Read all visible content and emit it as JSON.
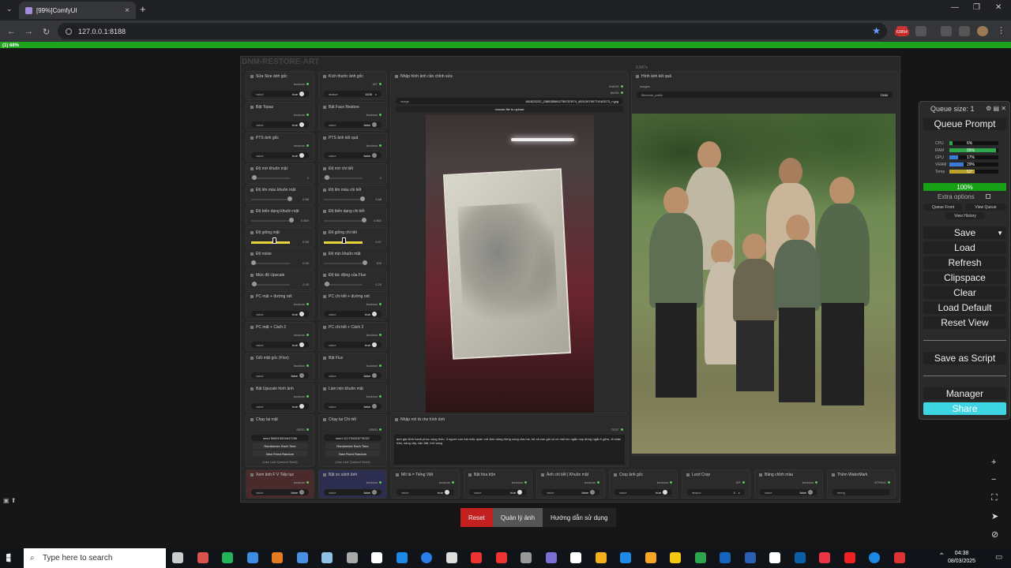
{
  "browser": {
    "tab_title": "[99%]ComfyUI",
    "url": "127.0.0.1:8188",
    "ext_badge": "63854"
  },
  "progress_text": "(1) 68%",
  "group_title": "DNM-RESTORE-ART",
  "nodes": {
    "n1": {
      "title": "Sửa Size ảnh gốc",
      "type": "boolean",
      "val": "true",
      "w": "value"
    },
    "n2": {
      "title": "Kích thước ảnh gốc",
      "type": "INT",
      "val": "1536",
      "w": "value"
    },
    "n3": {
      "title": "Bật Topaz",
      "type": "boolean",
      "val": "true",
      "w": "value"
    },
    "n4": {
      "title": "Bật Face Restore",
      "type": "boolean",
      "val": "false",
      "w": "value"
    },
    "n5": {
      "title": "PTS ảnh gốc",
      "type": "boolean",
      "val": "true",
      "w": "value"
    },
    "n6": {
      "title": "PTS ảnh kết quả",
      "type": "boolean",
      "val": "false",
      "w": "value"
    },
    "n7": {
      "title": "Độ mờ khuôn mặt",
      "val": "2"
    },
    "n8": {
      "title": "Độ mờ chi tiết",
      "val": "2"
    },
    "n9": {
      "title": "Độ lên màu khuôn mặt",
      "val": "0.88"
    },
    "n10": {
      "title": "Độ lên màu chi tiết",
      "val": "0.88"
    },
    "n11": {
      "title": "Độ biến dạng khuôn mặt",
      "val": "0.850"
    },
    "n12": {
      "title": "Độ biến dạng chi tiết",
      "val": "0.850"
    },
    "n13": {
      "title": "Độ giống mặt",
      "val": "0.55"
    },
    "n14": {
      "title": "Độ giống chi tiết",
      "val": "0.57"
    },
    "n15": {
      "title": "Độ noise",
      "val": "0.00"
    },
    "n16": {
      "title": "Độ mịn khuôn mặt",
      "val": "100"
    },
    "n17": {
      "title": "Mức độ Upscale",
      "val": "2.00"
    },
    "n18": {
      "title": "Độ tác động của Flux",
      "val": "0.20"
    },
    "n19": {
      "title": "PC mặt + đường nét",
      "type": "boolean",
      "val": "true",
      "w": "value"
    },
    "n20": {
      "title": "PC chi tiết + đường nét",
      "type": "boolean",
      "val": "true",
      "w": "value"
    },
    "n21": {
      "title": "PC mặt + Cách 2",
      "type": "boolean",
      "val": "true",
      "w": "value"
    },
    "n22": {
      "title": "PC chi tiết + Cách 2",
      "type": "boolean",
      "val": "true",
      "w": "value"
    },
    "n23": {
      "title": "Giữ mặt gốc (Flux)",
      "type": "boolean",
      "val": "false",
      "w": "value"
    },
    "n24": {
      "title": "Bật Flux",
      "type": "boolean",
      "val": "false",
      "w": "value"
    },
    "n25": {
      "title": "Bật Upscale hình ảnh",
      "type": "boolean",
      "val": "true",
      "w": "value"
    },
    "n26": {
      "title": "Làm mịn khuôn mặt",
      "type": "boolean",
      "val": "false",
      "w": "value"
    }
  },
  "seed_a": {
    "title": "Chạy lại mặt",
    "type": "SEED",
    "seed": "seed 568515926647286",
    "rand": "Randomize Each Time",
    "fixed": "New Fixed Random",
    "last": "(Use Last Queued Seed)"
  },
  "seed_b": {
    "title": "Chạy lại Chi tiết",
    "type": "SEED",
    "seed": "seed 121750328778337",
    "rand": "Randomize Each Time",
    "fixed": "New Fixed Random",
    "last": "(Use Last Queued Seed)"
  },
  "input_node": {
    "title": "Nhập hình ảnh cần chỉnh sửa",
    "out1": "IMAGE",
    "out2": "MASK",
    "label": "image",
    "file": "481823222_2368355842758757874_463130790774183273_n.jpg",
    "upload": "choose file to upload"
  },
  "result_node": {
    "title": "Hình ảnh kết quả",
    "label_in": "images",
    "prefix_label": "filename_prefix",
    "prefix_val": "DNM",
    "size": "0.847s"
  },
  "text_node": {
    "title": "Nhập mô tả cho hình ảnh",
    "type": "TEXT",
    "text": "ảnh gia đình hạnh phúc vùng thôn, 3 người con trai mặc quần với đơn dòng đứng cùng cha mẹ, kệ cả con gái có cô mái tóc ngắn cạp đứng ngắt ở giữa, đi chân trần, sáng cây, sân đất, trời sáng"
  },
  "bottom_nodes": [
    {
      "title": "Xem ảnh F V Tiếp tục",
      "type": "boolean",
      "w": "value",
      "val": "false"
    },
    {
      "title": "Bật so sánh ảnh",
      "type": "boolean",
      "w": "value",
      "val": "false"
    },
    {
      "title": "Mô tả = Tiếng Việt",
      "type": "boolean",
      "w": "value",
      "val": "true"
    },
    {
      "title": "Bật hòa trộn",
      "type": "boolean",
      "w": "value",
      "val": "true"
    },
    {
      "title": "Ảnh chi tiết | Khuôn mặt",
      "type": "boolean",
      "w": "value",
      "val": "false"
    },
    {
      "title": "Crop ảnh gốc",
      "type": "boolean",
      "w": "value",
      "val": "true"
    },
    {
      "title": "Lượt Crop",
      "type": "INT",
      "w": "value",
      "val": "1"
    },
    {
      "title": "Bảng chỉnh màu",
      "type": "boolean",
      "w": "value",
      "val": "false"
    },
    {
      "title": "Thêm WaterMark",
      "type": "STRING",
      "w": "string",
      "val": ""
    }
  ],
  "queue": {
    "title": "Queue size: 1",
    "queue_prompt": "Queue Prompt",
    "stats": [
      {
        "label": "CPU",
        "pct": "6%",
        "v": 0.06,
        "color": "#2ea84a"
      },
      {
        "label": "RAM",
        "pct": "95%",
        "v": 0.95,
        "color": "#2ea84a"
      },
      {
        "label": "GPU",
        "pct": "17%",
        "v": 0.17,
        "color": "#3a7bd5"
      },
      {
        "label": "VRAM",
        "pct": "29%",
        "v": 0.29,
        "color": "#3a7bd5"
      },
      {
        "label": "Temp",
        "pct": "52°",
        "v": 0.52,
        "color": "#b9a12a"
      }
    ],
    "percent": "100%",
    "extra": "Extra options",
    "queue_front": "Queue Front",
    "view_queue": "View Queue",
    "view_history": "View History",
    "save": "Save",
    "load": "Load",
    "refresh": "Refresh",
    "clipspace": "Clipspace",
    "clear": "Clear",
    "load_default": "Load Default",
    "reset_view": "Reset View",
    "save_script": "Save as Script",
    "manager": "Manager",
    "share": "Share"
  },
  "actions": {
    "reset": "Reset",
    "manage": "Quản lý ảnh",
    "guide": "Hướng dẫn sử dụng"
  },
  "taskbar": {
    "search": "Type here to search",
    "time": "04:38",
    "date": "08/03/2025"
  }
}
